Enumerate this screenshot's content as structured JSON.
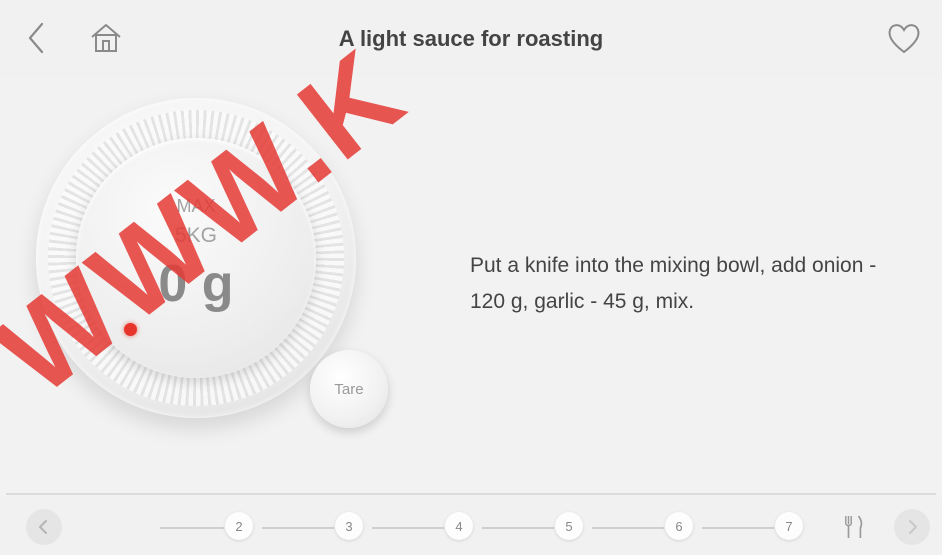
{
  "header": {
    "title": "A light sauce for roasting",
    "back_icon": "chevron-left-icon",
    "home_icon": "home-icon",
    "favorite_icon": "heart-outline-icon"
  },
  "scale": {
    "max_label": "MAX",
    "capacity": "5KG",
    "weight": "0 g",
    "tare_label": "Tare",
    "indicator_color": "#e8352b"
  },
  "instruction": "Put a knife into the mixing bowl, add onion - 120 g, garlic - 45 g, mix.",
  "footer": {
    "prev_icon": "chevron-left-icon",
    "next_icon": "chevron-right-icon",
    "utensils_icon": "fork-knife-icon",
    "steps": [
      "2",
      "3",
      "4",
      "5",
      "6",
      "7"
    ]
  },
  "watermark": "WWW.K"
}
